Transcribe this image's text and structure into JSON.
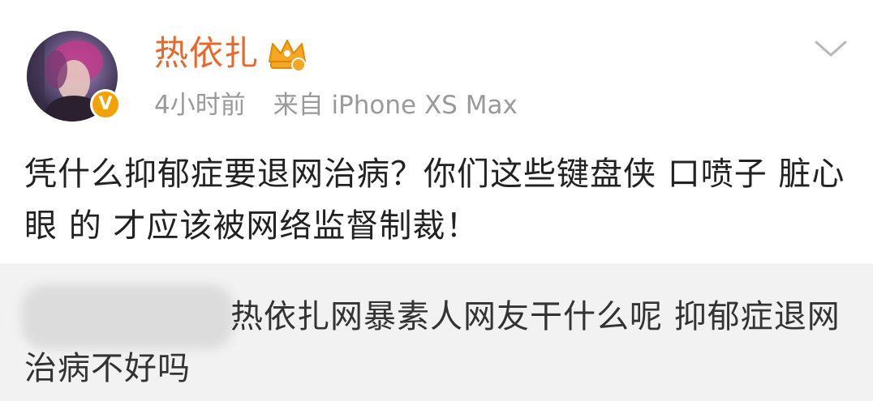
{
  "post": {
    "username": "热依扎",
    "time": "4小时前",
    "source": "来自 iPhone XS Max",
    "verified_badge": "V",
    "content": "凭什么抑郁症要退网治病？你们这些键盘侠 口喷子 脏心眼 的 才应该被网络监督制裁！"
  },
  "repost": {
    "text": "热依扎网暴素人网友干什么呢 抑郁症退网治病不好吗"
  },
  "colors": {
    "username": "#e8672a",
    "meta": "#9a9a9a",
    "badge": "#f3a200",
    "repost_bg": "#f2f2f2"
  },
  "icons": {
    "crown": "crown-icon",
    "chevron": "chevron-down-icon",
    "verified": "verified-icon"
  }
}
